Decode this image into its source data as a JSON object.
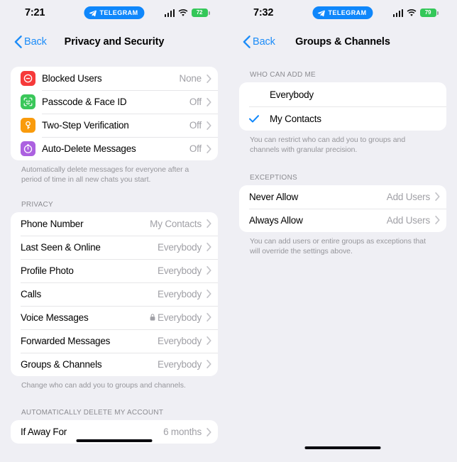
{
  "screens": [
    {
      "id": "privacy-and-security",
      "status_bar": {
        "time": "7:21",
        "app_pill_label": "TELEGRAM",
        "app_pill_icon": "telegram-plane-icon",
        "cellular_icon": "signal-bars-icon",
        "wifi_icon": "wifi-icon",
        "battery_percent": "72",
        "battery_charging": true,
        "battery_color": "#34c759"
      },
      "nav": {
        "back_label": "Back",
        "back_icon": "chevron-left-icon",
        "title": "Privacy and Security"
      },
      "sections": [
        {
          "header": "",
          "rows": [
            {
              "icon": "blocked-users-icon",
              "icon_color": "#f63a3a",
              "label": "Blocked Users",
              "value": "None",
              "chevron": true
            },
            {
              "icon": "face-id-icon",
              "icon_color": "#3ac75a",
              "label": "Passcode & Face ID",
              "value": "Off",
              "chevron": true
            },
            {
              "icon": "key-icon",
              "icon_color": "#f99b0c",
              "label": "Two-Step Verification",
              "value": "Off",
              "chevron": true
            },
            {
              "icon": "auto-delete-timer-icon",
              "icon_color": "#ac61e0",
              "label": "Auto-Delete Messages",
              "value": "Off",
              "chevron": true
            }
          ],
          "footnote": "Automatically delete messages for everyone after a period of time in all new chats you start."
        },
        {
          "header": "PRIVACY",
          "rows": [
            {
              "label": "Phone Number",
              "value": "My Contacts",
              "chevron": true
            },
            {
              "label": "Last Seen & Online",
              "value": "Everybody",
              "chevron": true
            },
            {
              "label": "Profile Photo",
              "value": "Everybody",
              "chevron": true
            },
            {
              "label": "Calls",
              "value": "Everybody",
              "chevron": true
            },
            {
              "label": "Voice Messages",
              "value": "Everybody",
              "value_icon": "lock-icon",
              "chevron": true
            },
            {
              "label": "Forwarded Messages",
              "value": "Everybody",
              "chevron": true
            },
            {
              "label": "Groups & Channels",
              "value": "Everybody",
              "chevron": true
            }
          ],
          "footnote": "Change who can add you to groups and channels."
        },
        {
          "header": "AUTOMATICALLY DELETE MY ACCOUNT",
          "rows": [
            {
              "label": "If Away For",
              "value": "6 months",
              "chevron": true
            }
          ],
          "footnote": ""
        }
      ]
    },
    {
      "id": "groups-and-channels",
      "status_bar": {
        "time": "7:32",
        "app_pill_label": "TELEGRAM",
        "app_pill_icon": "telegram-plane-icon",
        "cellular_icon": "signal-bars-icon",
        "wifi_icon": "wifi-icon",
        "battery_percent": "79",
        "battery_charging": true,
        "battery_color": "#34c759"
      },
      "nav": {
        "back_label": "Back",
        "back_icon": "chevron-left-icon",
        "title": "Groups & Channels"
      },
      "sections": [
        {
          "header": "WHO CAN ADD ME",
          "rows": [
            {
              "label": "Everybody",
              "selected": false
            },
            {
              "label": "My Contacts",
              "selected": true,
              "check_icon": "checkmark-icon",
              "check_color": "#0f87fb"
            }
          ],
          "footnote": "You can restrict who can add you to groups and channels with granular precision."
        },
        {
          "header": "EXCEPTIONS",
          "rows": [
            {
              "label": "Never Allow",
              "value": "Add Users",
              "chevron": true
            },
            {
              "label": "Always Allow",
              "value": "Add Users",
              "chevron": true
            }
          ],
          "footnote": "You can add users or entire groups as exceptions that will override the settings above."
        }
      ]
    }
  ],
  "theme": {
    "background": "#efeff4",
    "card": "#ffffff",
    "accent": "#0f87fb",
    "link": "#1c8cf8",
    "secondary_text": "#a0a0a6",
    "header_text": "#8b8b90"
  }
}
